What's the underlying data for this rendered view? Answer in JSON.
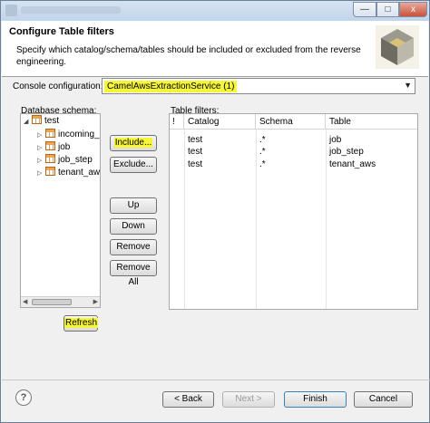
{
  "window": {
    "title_blurred": "",
    "minimize": "—",
    "maximize": "□",
    "close": "x"
  },
  "header": {
    "title": "Configure Table filters",
    "description": "Specify which catalog/schema/tables should be included or excluded from the reverse engineering."
  },
  "console": {
    "label": "Console configuration:",
    "value": "CamelAwsExtractionService (1)"
  },
  "schema": {
    "label": "Database schema:",
    "root": "test",
    "children": [
      "incoming_",
      "job",
      "job_step",
      "tenant_aws"
    ]
  },
  "buttons": {
    "include": "Include...",
    "exclude": "Exclude...",
    "up": "Up",
    "down": "Down",
    "remove": "Remove",
    "remove_all": "Remove All",
    "refresh": "Refresh"
  },
  "filters": {
    "label": "Table filters:",
    "columns": [
      "!",
      "Catalog",
      "Schema",
      "Table"
    ],
    "rows": [
      {
        "catalog": "test",
        "schema": ".*",
        "table": "job"
      },
      {
        "catalog": "test",
        "schema": ".*",
        "table": "job_step"
      },
      {
        "catalog": "test",
        "schema": ".*",
        "table": "tenant_aws"
      }
    ]
  },
  "footer": {
    "help": "?",
    "back": "< Back",
    "next": "Next >",
    "finish": "Finish",
    "cancel": "Cancel"
  },
  "colors": {
    "highlight": "#f5f53a",
    "accent": "#3c7fb1"
  }
}
